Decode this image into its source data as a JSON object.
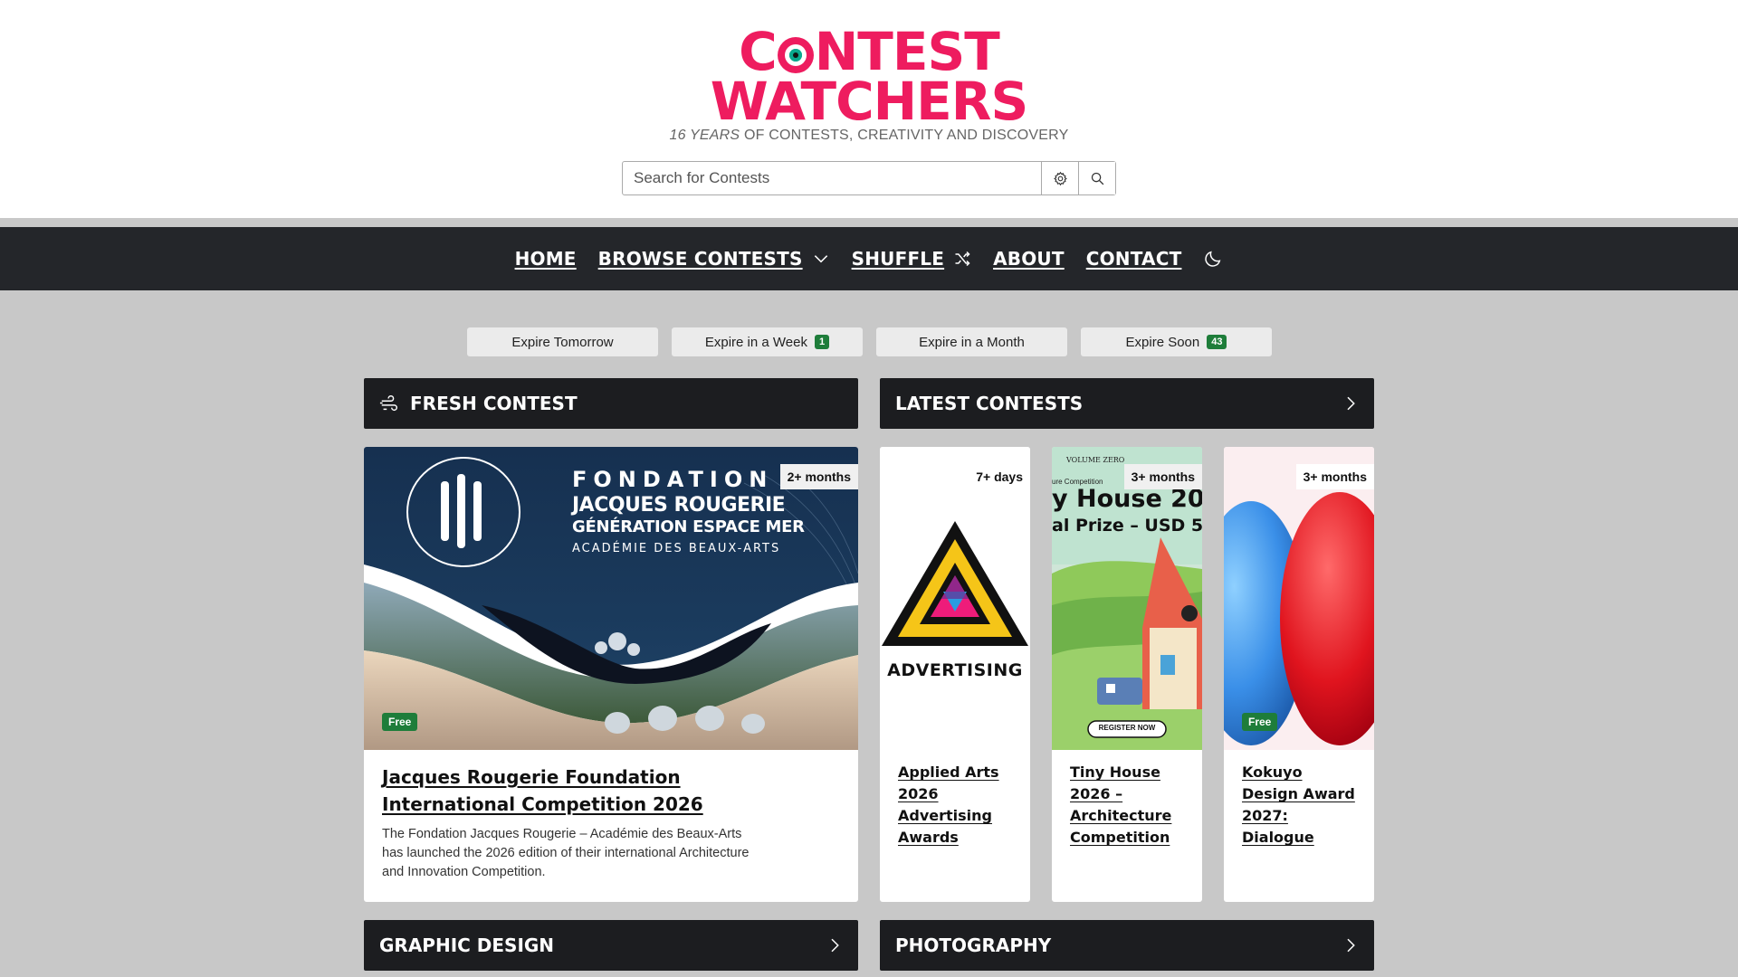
{
  "header": {
    "logo_line1": "CONTEST",
    "logo_line1_before_eye": "C",
    "logo_line1_after_eye": "NTEST",
    "logo_line2": "WATCHERS",
    "tagline_years": "16 YEARS",
    "tagline_rest": "OF CONTESTS, CREATIVITY AND DISCOVERY",
    "brand_color": "#ee1c5f"
  },
  "search": {
    "placeholder": "Search for Contests",
    "settings_icon": "gear-icon",
    "search_icon": "search-icon"
  },
  "nav": {
    "home": "HOME",
    "browse": "BROWSE CONTESTS",
    "shuffle": "SHUFFLE",
    "about": "ABOUT",
    "contact": "CONTACT",
    "theme_icon": "moon-icon"
  },
  "filters": [
    {
      "label": "Expire Tomorrow",
      "count": ""
    },
    {
      "label": "Expire in a Week",
      "count": "1"
    },
    {
      "label": "Expire in a Month",
      "count": ""
    },
    {
      "label": "Expire Soon",
      "count": "43"
    }
  ],
  "sections": {
    "fresh": "FRESH CONTEST",
    "latest": "LATEST CONTESTS",
    "graphic": "GRAPHIC DESIGN",
    "photo": "PHOTOGRAPHY"
  },
  "fresh_card": {
    "time": "2+ months",
    "free": "Free",
    "title": "Jacques Rougerie Foundation International Competition 2026",
    "description": "The Fondation Jacques Rougerie – Académie des Beaux-Arts has launched the 2026 edition of their international Architecture and Innovation Competition.",
    "image_text": {
      "line1": "FONDATION",
      "line2": "JACQUES ROUGERIE",
      "line3": "GÉNÉRATION ESPACE MER",
      "line4": "ACADÉMIE DES BEAUX-ARTS"
    }
  },
  "latest_cards": [
    {
      "time": "7+ days",
      "title": "Applied Arts 2026 Advertising Awards",
      "free": "",
      "image_text": "ADVERTISING"
    },
    {
      "time": "3+ months",
      "title": "Tiny House 2026 – Architecture Competition",
      "free": "",
      "image_text": {
        "a": "VOLUME ZERO",
        "b": "ure Competition",
        "c": "y House 20",
        "d": "al Prize – USD 5",
        "e": "REGISTER NOW"
      }
    },
    {
      "time": "3+ months",
      "title": "Kokuyo Design Award 2027: Dialogue",
      "free": "Free",
      "image_text": ""
    }
  ]
}
